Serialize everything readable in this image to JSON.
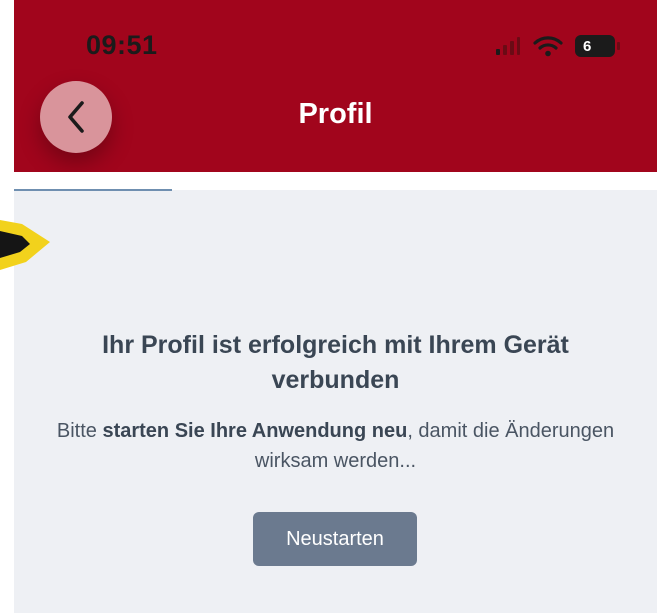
{
  "status_bar": {
    "time": "09:51",
    "battery_level": "6",
    "signal_icon": "cellular-signal-icon",
    "wifi_icon": "wifi-icon"
  },
  "header": {
    "title": "Profil",
    "back_icon": "chevron-left-icon"
  },
  "message": {
    "headline": "Ihr Profil ist erfolgreich mit Ihrem Gerät verbunden",
    "body_prefix": "Bitte ",
    "body_bold": "starten Sie Ihre Anwendung neu",
    "body_suffix": ", damit die Änderungen wirksam werden..."
  },
  "actions": {
    "restart_label": "Neustarten"
  },
  "colors": {
    "header_bg": "#a1051c",
    "content_bg": "#eef0f4",
    "button_bg": "#6b7a8f",
    "annotation": "#f2d21c"
  }
}
